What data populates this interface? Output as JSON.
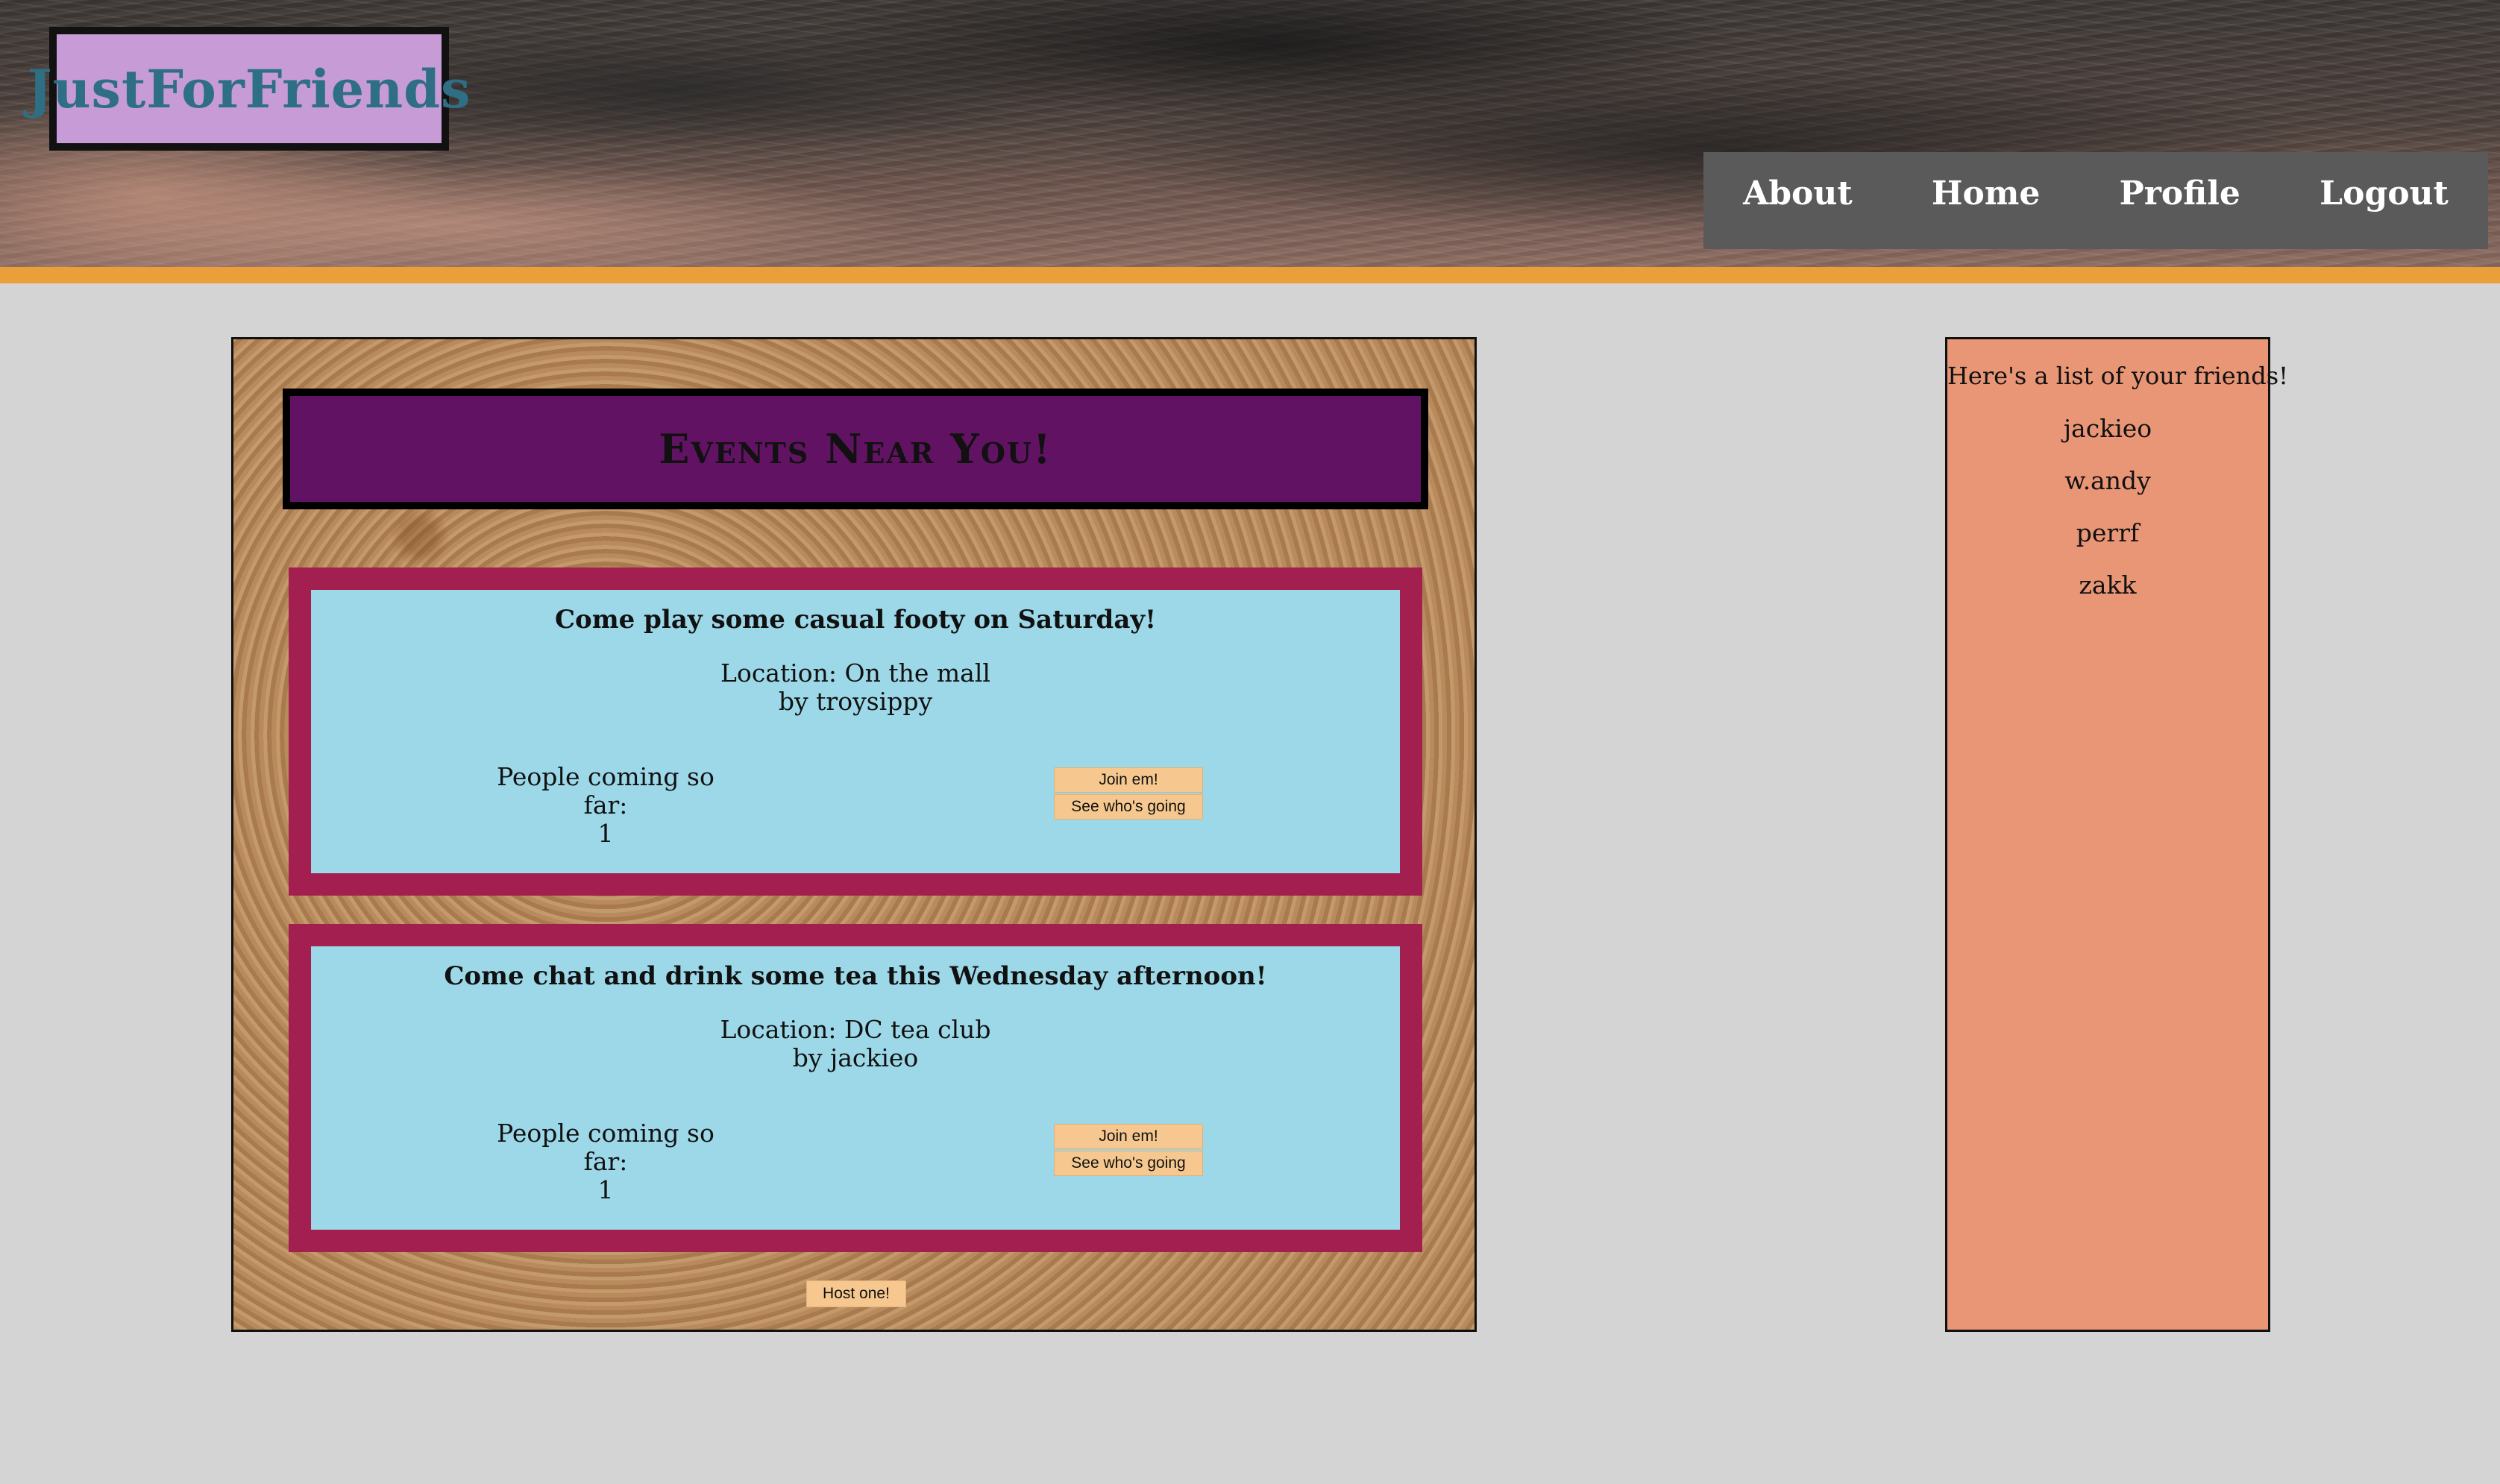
{
  "header": {
    "logo": "JustForFriends",
    "nav": [
      "About",
      "Home",
      "Profile",
      "Logout"
    ]
  },
  "board": {
    "title": "Events Near You!",
    "events": [
      {
        "title": "Come play some casual footy on Saturday!",
        "location": "Location: On the mall",
        "host": "by troysippy",
        "coming_label": "People coming so far:",
        "coming_count": "1",
        "join_label": "Join em!",
        "see_label": "See who's going"
      },
      {
        "title": "Come chat and drink some tea this Wednesday afternoon!",
        "location": "Location: DC tea club",
        "host": "by jackieo",
        "coming_label": "People coming so far:",
        "coming_count": "1",
        "join_label": "Join em!",
        "see_label": "See who's going"
      }
    ],
    "host_button": "Host one!"
  },
  "friends": {
    "heading": "Here's a list of your friends!",
    "list": [
      "jackieo",
      "w.andy",
      "perrf",
      "zakk"
    ]
  },
  "colors": {
    "background": "#d4d4d4",
    "accent_stripe": "#eb9f3a",
    "logo_bg": "#c69bd6",
    "logo_text": "#2f6f86",
    "nav_bg": "#5a5a5a",
    "title_bg": "#621263",
    "card_border": "#a21f4f",
    "card_bg": "#9cd8e8",
    "button_bg": "#f6c88f",
    "friends_bg": "#e99676"
  }
}
